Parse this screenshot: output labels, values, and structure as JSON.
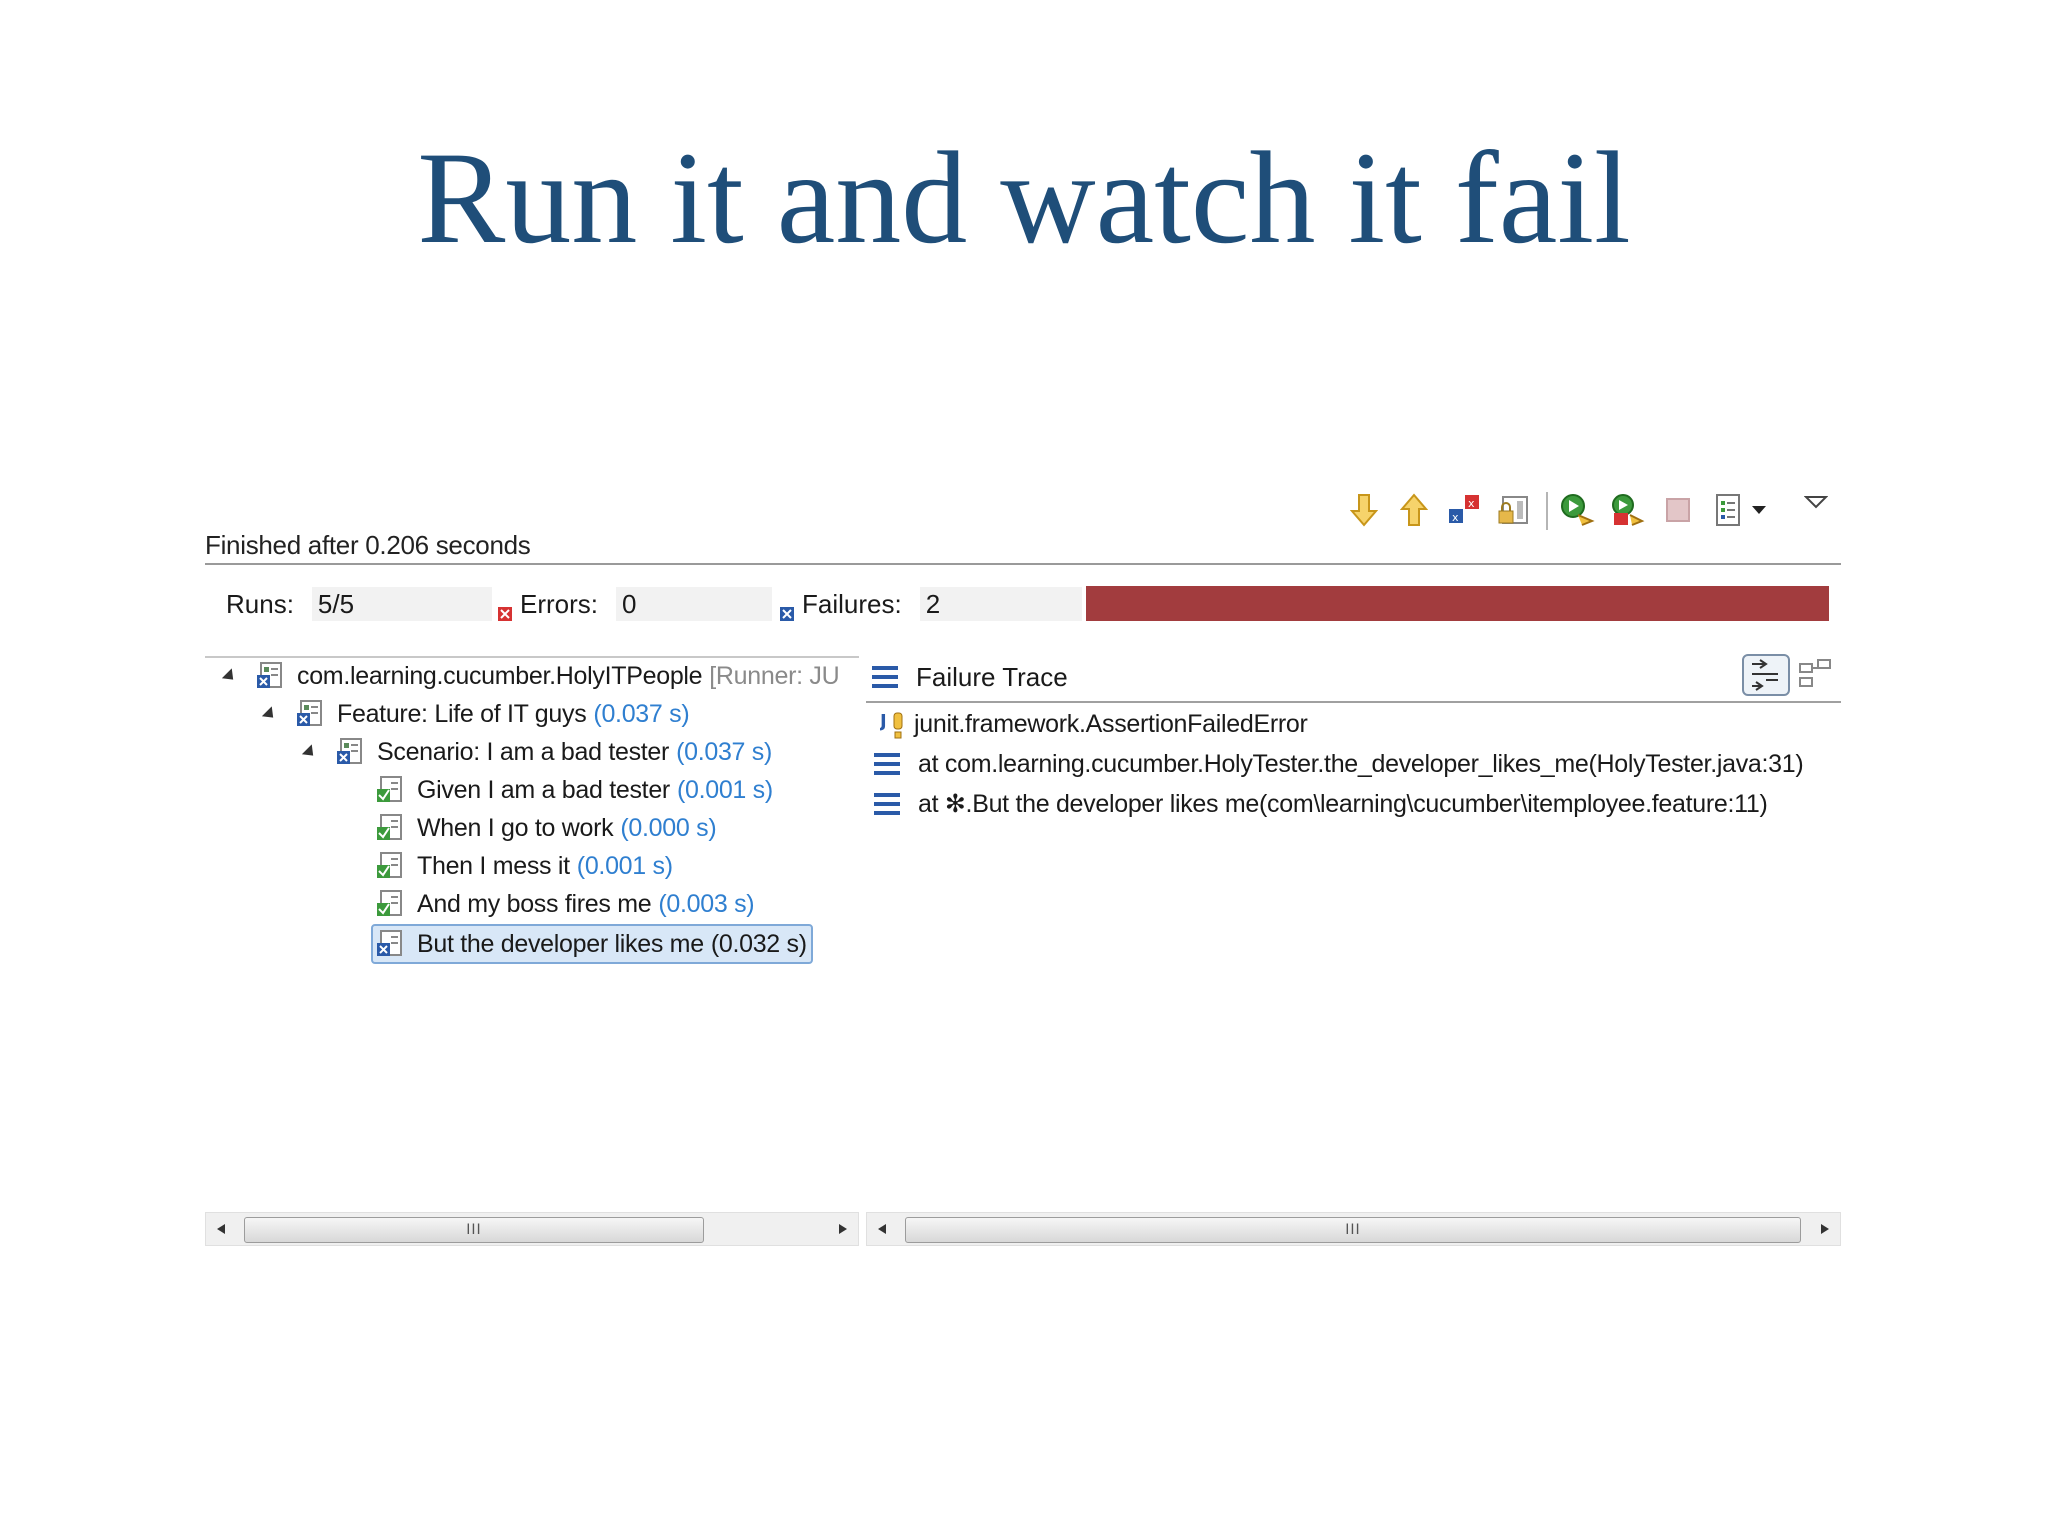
{
  "slide": {
    "title": "Run it and watch it fail"
  },
  "status": {
    "finished_text": "Finished after 0.206 seconds"
  },
  "counters": {
    "runs_label": "Runs:",
    "runs_value": "5/5",
    "errors_label": "Errors:",
    "errors_value": "0",
    "failures_label": "Failures:",
    "failures_value": "2"
  },
  "progress": {
    "state": "failed",
    "fraction": 1.0,
    "color": "#a23c3e"
  },
  "toolbar": {
    "icons": [
      "next-failure-icon",
      "previous-failure-icon",
      "show-failures-only-icon",
      "scroll-lock-icon",
      "rerun-test-icon",
      "rerun-failed-first-icon",
      "stop-icon",
      "test-run-history-icon",
      "history-dropdown-icon",
      "view-menu-icon"
    ]
  },
  "tree": {
    "root": {
      "label": "com.learning.cucumber.HolyITPeople",
      "runner": "[Runner: JU"
    },
    "feature": {
      "label": "Feature: Life of IT guys",
      "time": "(0.037 s)"
    },
    "scenario": {
      "label": "Scenario: I am a bad tester",
      "time": "(0.037 s)"
    },
    "steps": [
      {
        "label": "Given I am a bad tester",
        "time": "(0.001 s)",
        "status": "passed"
      },
      {
        "label": "When I go to work",
        "time": "(0.000 s)",
        "status": "passed"
      },
      {
        "label": "Then I mess it",
        "time": "(0.001 s)",
        "status": "passed"
      },
      {
        "label": "And my boss fires me",
        "time": "(0.003 s)",
        "status": "passed"
      },
      {
        "label": "But the developer likes me",
        "time": "(0.032 s)",
        "status": "failed"
      }
    ]
  },
  "trace": {
    "header": "Failure Trace",
    "lines": [
      "junit.framework.AssertionFailedError",
      "at com.learning.cucumber.HolyTester.the_developer_likes_me(HolyTester.java:31)",
      "at ✻.But the developer likes me(com\\learning\\cucumber\\itemployee.feature:11)"
    ]
  },
  "scrollbars": {
    "thumb_grip": "III"
  },
  "colors": {
    "title": "#1f4e79",
    "time": "#2f7fd0",
    "failure_bar": "#a23c3e",
    "selection": "#d8e7f7"
  }
}
